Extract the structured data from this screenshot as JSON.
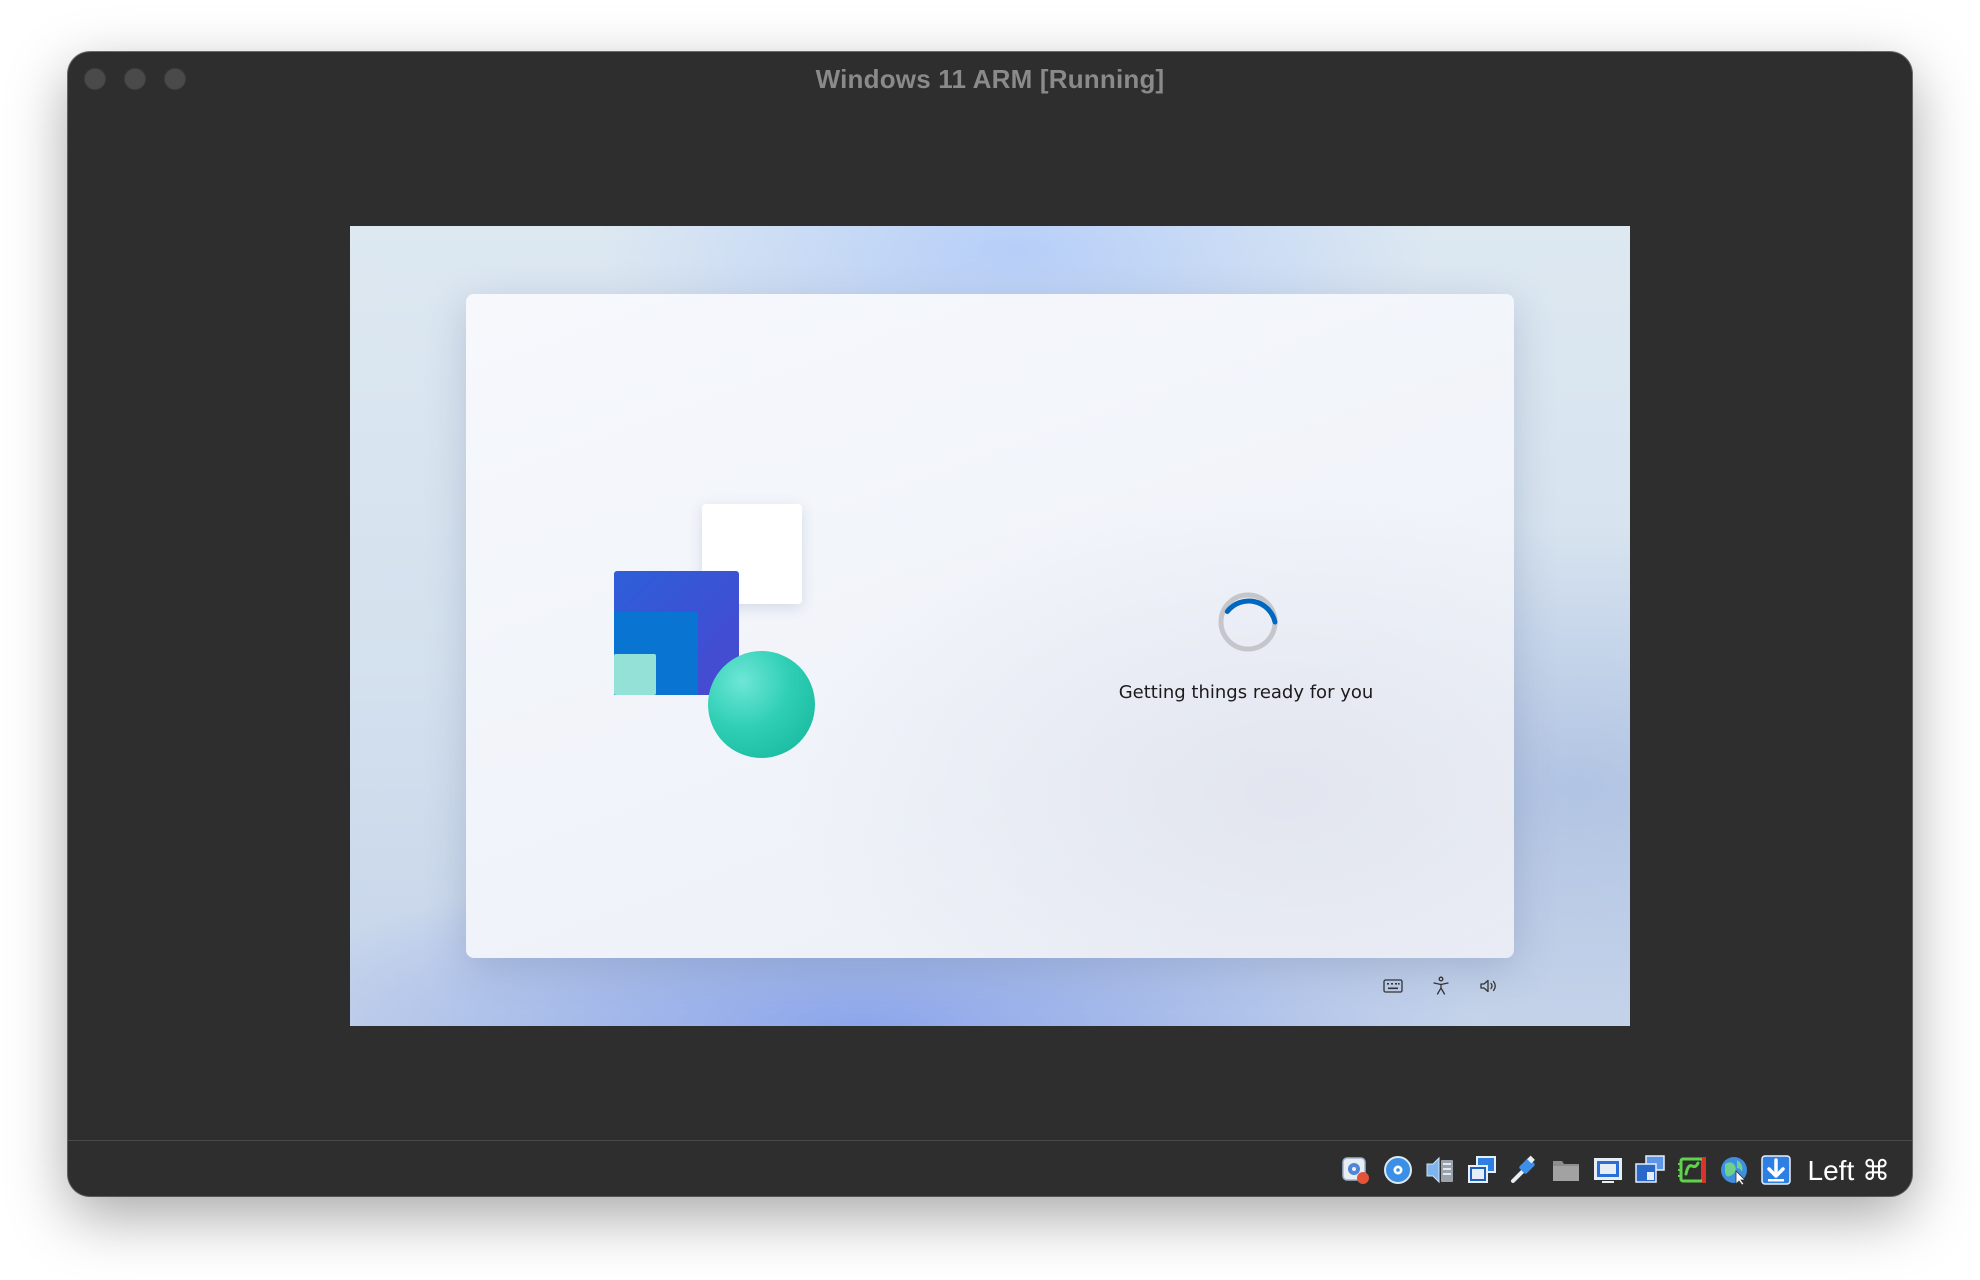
{
  "window": {
    "title": "Windows 11 ARM [Running]",
    "traffic_lights": [
      "close",
      "minimize",
      "zoom"
    ]
  },
  "guest": {
    "status_text": "Getting things ready for you",
    "spinner": {
      "accent": "#0067c0",
      "track": "#c4c6cc"
    },
    "tray_icons": [
      "keyboard-icon",
      "accessibility-icon",
      "volume-icon"
    ]
  },
  "statusbar": {
    "icons": [
      "hard-disk-icon",
      "optical-drive-icon",
      "audio-icon",
      "network-icon",
      "usb-icon",
      "shared-folders-icon",
      "display-icon",
      "recording-icon",
      "cpu-icon",
      "mouse-integration-icon",
      "keyboard-capture-icon"
    ],
    "host_key": "Left ⌘"
  },
  "colors": {
    "window_bg": "#2e2e2e",
    "title_text": "#8a8a8a",
    "accent_blue": "#2d7fe3"
  }
}
